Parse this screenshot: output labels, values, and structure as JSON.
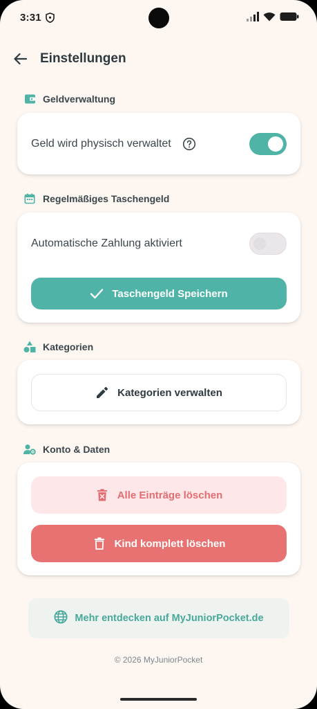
{
  "status_bar": {
    "time": "3:31"
  },
  "header": {
    "title": "Einstellungen"
  },
  "sections": {
    "money": {
      "title": "Geldverwaltung",
      "physical_label": "Geld wird physisch verwaltet",
      "physical_enabled": true
    },
    "allowance": {
      "title": "Regelmäßiges Taschengeld",
      "auto_payment_label": "Automatische Zahlung aktiviert",
      "auto_payment_enabled": false,
      "save_label": "Taschengeld Speichern"
    },
    "categories": {
      "title": "Kategorien",
      "manage_label": "Kategorien verwalten"
    },
    "account": {
      "title": "Konto & Daten",
      "delete_entries_label": "Alle Einträge löschen",
      "delete_child_label": "Kind komplett löschen"
    }
  },
  "discover": {
    "label": "Mehr entdecken auf MyJuniorPocket.de"
  },
  "footer": {
    "copyright": "© 2026 MyJuniorPocket"
  },
  "colors": {
    "accent": "#50b3a7",
    "danger": "#e87272",
    "danger_light": "#fde7e8",
    "background": "#fdf6f1"
  }
}
